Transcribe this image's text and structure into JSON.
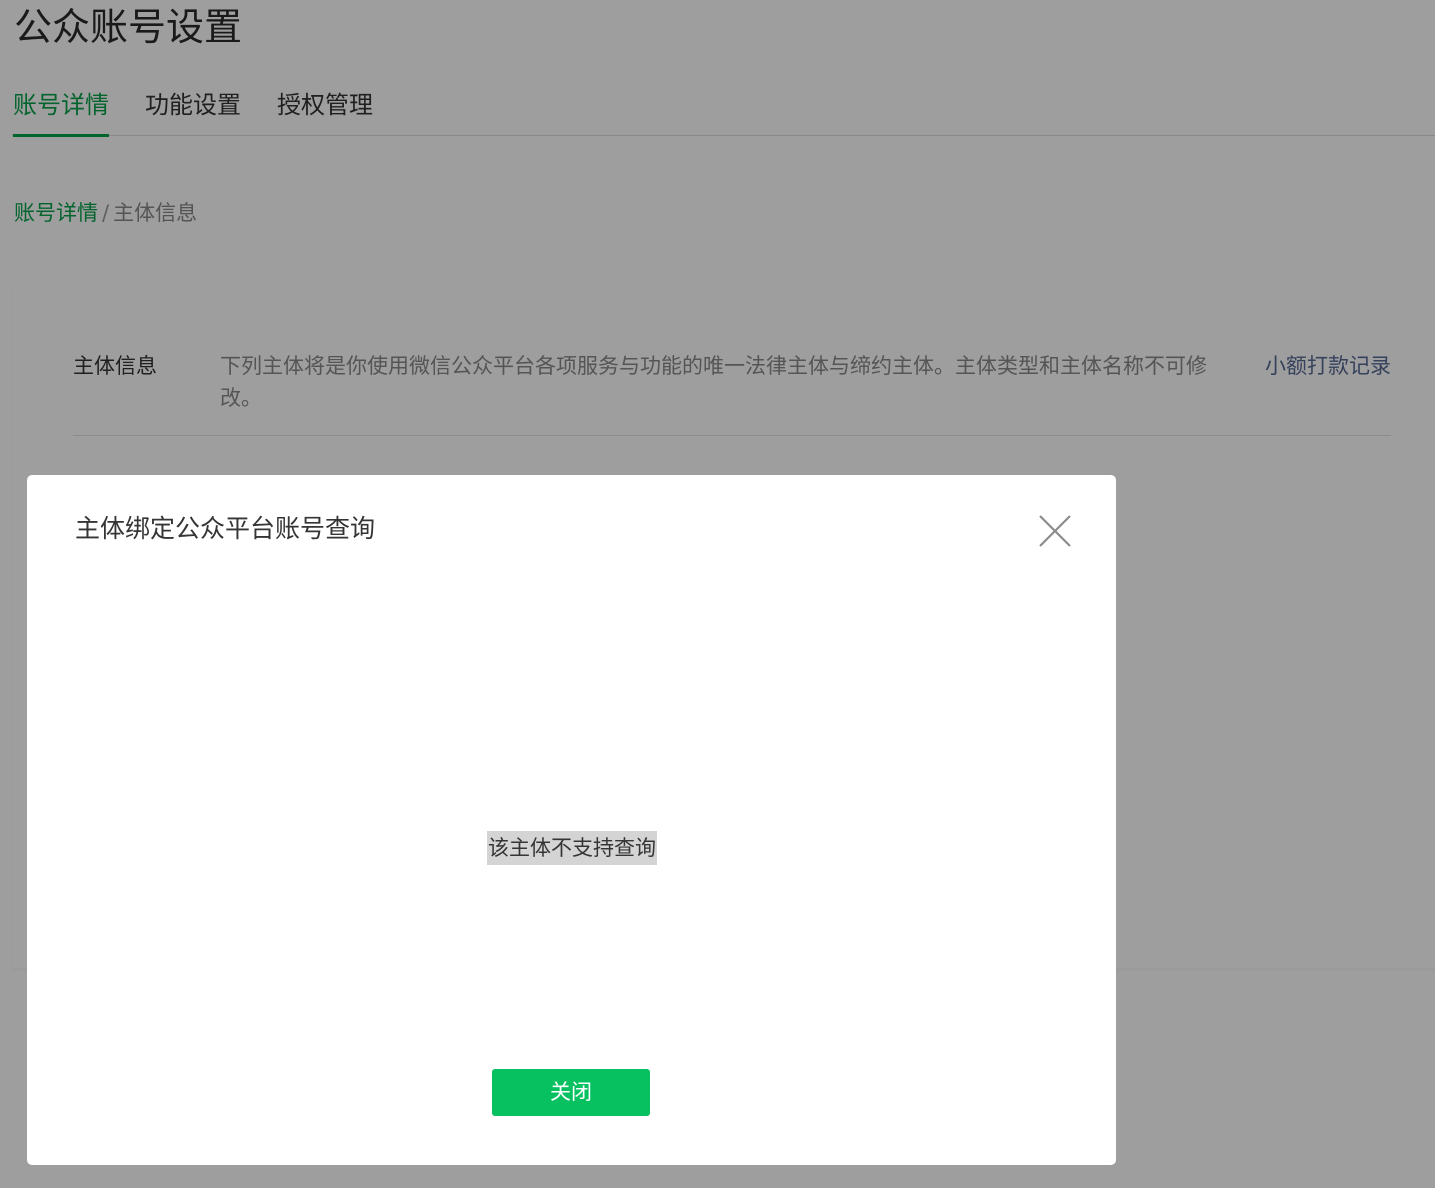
{
  "page": {
    "title": "公众账号设置",
    "tabs": [
      {
        "label": "账号详情",
        "active": true
      },
      {
        "label": "功能设置",
        "active": false
      },
      {
        "label": "授权管理",
        "active": false
      }
    ],
    "breadcrumb": {
      "link": "账号详情",
      "separator": "/",
      "current": "主体信息"
    }
  },
  "info": {
    "label": "主体信息",
    "description": "下列主体将是你使用微信公众平台各项服务与功能的唯一法律主体与缔约主体。主体类型和主体名称不可修改。",
    "link": "小额打款记录"
  },
  "dialog": {
    "title": "主体绑定公众平台账号查询",
    "message": "该主体不支持查询",
    "close_button": "关闭",
    "close_icon": "close-icon"
  },
  "colors": {
    "accent": "#07a24b",
    "button": "#07c160",
    "link": "#576b95"
  }
}
